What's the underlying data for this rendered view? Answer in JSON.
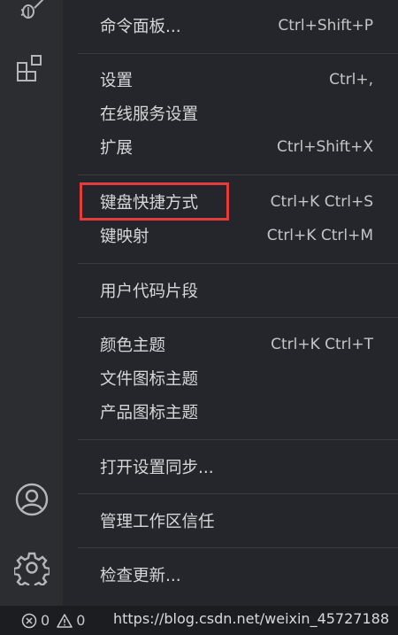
{
  "menu": {
    "groups": [
      {
        "items": [
          {
            "label": "命令面板...",
            "shortcut": "Ctrl+Shift+P"
          }
        ]
      },
      {
        "items": [
          {
            "label": "设置",
            "shortcut": "Ctrl+,"
          },
          {
            "label": "在线服务设置",
            "shortcut": ""
          },
          {
            "label": "扩展",
            "shortcut": "Ctrl+Shift+X"
          }
        ]
      },
      {
        "items": [
          {
            "label": "键盘快捷方式",
            "shortcut": "Ctrl+K Ctrl+S"
          },
          {
            "label": "键映射",
            "shortcut": "Ctrl+K Ctrl+M"
          }
        ]
      },
      {
        "items": [
          {
            "label": "用户代码片段",
            "shortcut": ""
          }
        ]
      },
      {
        "items": [
          {
            "label": "颜色主题",
            "shortcut": "Ctrl+K Ctrl+T"
          },
          {
            "label": "文件图标主题",
            "shortcut": ""
          },
          {
            "label": "产品图标主题",
            "shortcut": ""
          }
        ]
      },
      {
        "items": [
          {
            "label": "打开设置同步...",
            "shortcut": ""
          }
        ]
      },
      {
        "items": [
          {
            "label": "管理工作区信任",
            "shortcut": ""
          }
        ]
      },
      {
        "items": [
          {
            "label": "检查更新...",
            "shortcut": ""
          }
        ]
      }
    ]
  },
  "activity_bar": {
    "icons": [
      "debug-icon",
      "extensions-icon",
      "account-icon",
      "manage-gear-icon"
    ]
  },
  "status_bar": {
    "errors": "0",
    "warnings": "0",
    "watermark": "https://blog.csdn.net/weixin_45727188"
  },
  "colors": {
    "highlight": "#e63b3b",
    "menu_bg": "#25262b",
    "activity_bg": "#2c2d31"
  }
}
